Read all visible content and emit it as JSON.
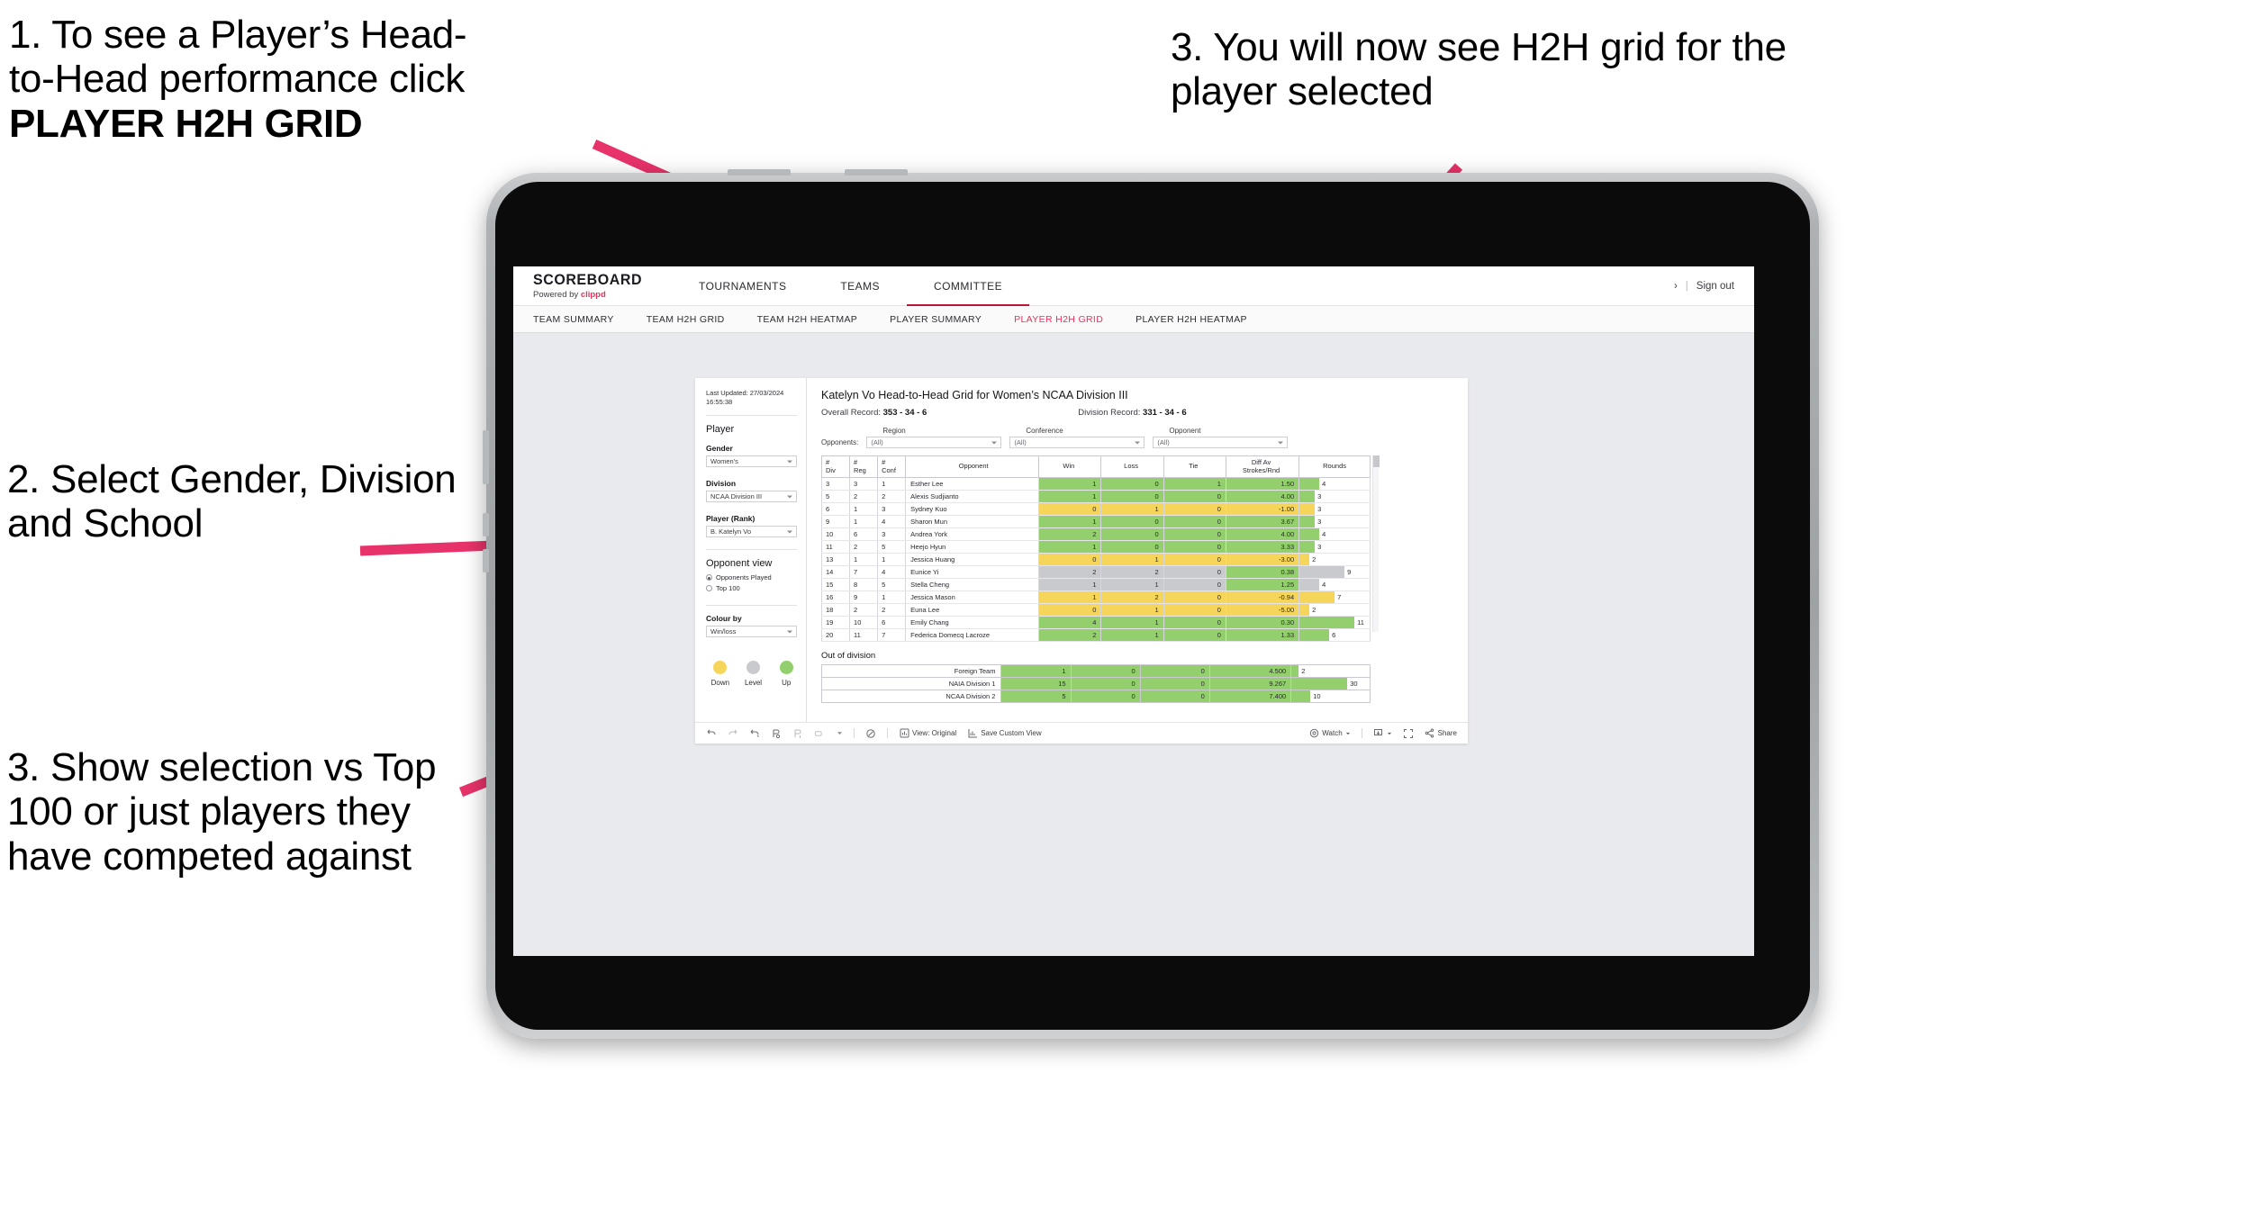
{
  "annotations": [
    {
      "id": "anno1",
      "line1": "1. To see a Player’s Head-",
      "line2": "to-Head performance click",
      "line3": "PLAYER H2H GRID"
    },
    {
      "id": "anno2",
      "text": "2. Select Gender, Division and School"
    },
    {
      "id": "anno3",
      "text": "3. Show selection vs Top 100 or just players they have competed against"
    },
    {
      "id": "anno4",
      "text": "3. You will now see H2H grid for the player selected"
    }
  ],
  "anno1_l1": "1. To see a Player’s Head-",
  "anno1_l2": "to-Head performance click",
  "anno1_l3": "PLAYER H2H GRID",
  "anno2_text": "2. Select Gender, Division and School",
  "anno3_text": "3. Show selection vs Top 100 or just players they have competed against",
  "anno4_text": "3. You will now see H2H grid for the player selected",
  "colors": {
    "accent_pink": "#e8335a",
    "arrow_pink": "#e8326a",
    "win_green": "#94cf6e",
    "loss_yellow": "#f5d65a",
    "level_grey": "#c9cacd",
    "active_tab_underline": "#c0133a"
  },
  "brand": {
    "title": "SCOREBOARD",
    "powered_prefix": "Powered by ",
    "powered_brand": "clippd"
  },
  "topnav": {
    "items": [
      {
        "label": "TOURNAMENTS",
        "active": false
      },
      {
        "label": "TEAMS",
        "active": false
      },
      {
        "label": "COMMITTEE",
        "active": true
      }
    ],
    "chevron": "›",
    "separator": "|",
    "signout": "Sign out"
  },
  "subnav": {
    "items": [
      {
        "label": "TEAM SUMMARY",
        "active": false
      },
      {
        "label": "TEAM H2H GRID",
        "active": false
      },
      {
        "label": "TEAM H2H HEATMAP",
        "active": false
      },
      {
        "label": "PLAYER SUMMARY",
        "active": false
      },
      {
        "label": "PLAYER H2H GRID",
        "active": true
      },
      {
        "label": "PLAYER H2H HEATMAP",
        "active": false
      }
    ]
  },
  "sidebar": {
    "last_updated_line1": "Last Updated: 27/03/2024",
    "last_updated_line2": "16:55:38",
    "player_heading": "Player",
    "gender_label": "Gender",
    "gender_value": "Women's",
    "division_label": "Division",
    "division_value": "NCAA Division III",
    "player_rank_label": "Player (Rank)",
    "player_rank_value": "B. Katelyn Vo",
    "opponent_view_heading": "Opponent view",
    "opponent_view_options": [
      {
        "label": "Opponents Played",
        "selected": true
      },
      {
        "label": "Top 100",
        "selected": false
      }
    ],
    "colour_by_label": "Colour by",
    "colour_by_value": "Win/loss",
    "legend": [
      {
        "label": "Down",
        "color": "#f5d65a"
      },
      {
        "label": "Level",
        "color": "#c9cacd"
      },
      {
        "label": "Up",
        "color": "#94cf6e"
      }
    ]
  },
  "main": {
    "title": "Katelyn Vo Head-to-Head Grid for Women’s NCAA Division III",
    "overall_record_label": "Overall Record: ",
    "overall_record_value": "353 -  34 - 6",
    "division_record_label": "Division Record: ",
    "division_record_value": "331 -  34 - 6",
    "opponents_label": "Opponents:",
    "filters": [
      {
        "title": "Region",
        "value": "(All)"
      },
      {
        "title": "Conference",
        "value": "(All)"
      },
      {
        "title": "Opponent",
        "value": "(All)"
      }
    ],
    "out_of_division_title": "Out of division"
  },
  "chart_data": {
    "type": "table",
    "title": "Katelyn Vo Head-to-Head Grid for Women’s NCAA Division III",
    "columns": [
      "# Div",
      "# Reg",
      "# Conf",
      "Opponent",
      "Win",
      "Loss",
      "Tie",
      "Diff Av Strokes/Rnd",
      "Rounds"
    ],
    "column_headers_multiline": [
      {
        "l1": "#",
        "l2": "Div"
      },
      {
        "l1": "#",
        "l2": "Reg"
      },
      {
        "l1": "#",
        "l2": "Conf"
      },
      {
        "l1": "Opponent",
        "l2": ""
      },
      {
        "l1": "Win",
        "l2": ""
      },
      {
        "l1": "Loss",
        "l2": ""
      },
      {
        "l1": "Tie",
        "l2": ""
      },
      {
        "l1": "Diff Av",
        "l2": "Strokes/Rnd"
      },
      {
        "l1": "Rounds",
        "l2": ""
      }
    ],
    "rounds_max": 12,
    "rows": [
      {
        "div": "3",
        "reg": "3",
        "conf": "1",
        "opponent": "Esther Lee",
        "win": "1",
        "loss": "0",
        "tie": "1",
        "diff": "1.50",
        "rounds": 4,
        "color": "#94cf6e"
      },
      {
        "div": "5",
        "reg": "2",
        "conf": "2",
        "opponent": "Alexis Sudjianto",
        "win": "1",
        "loss": "0",
        "tie": "0",
        "diff": "4.00",
        "rounds": 3,
        "color": "#94cf6e"
      },
      {
        "div": "6",
        "reg": "1",
        "conf": "3",
        "opponent": "Sydney Kuo",
        "win": "0",
        "loss": "1",
        "tie": "0",
        "diff": "-1.00",
        "rounds": 3,
        "color": "#f5d65a"
      },
      {
        "div": "9",
        "reg": "1",
        "conf": "4",
        "opponent": "Sharon Mun",
        "win": "1",
        "loss": "0",
        "tie": "0",
        "diff": "3.67",
        "rounds": 3,
        "color": "#94cf6e"
      },
      {
        "div": "10",
        "reg": "6",
        "conf": "3",
        "opponent": "Andrea York",
        "win": "2",
        "loss": "0",
        "tie": "0",
        "diff": "4.00",
        "rounds": 4,
        "color": "#94cf6e"
      },
      {
        "div": "11",
        "reg": "2",
        "conf": "5",
        "opponent": "Heejo Hyun",
        "win": "1",
        "loss": "0",
        "tie": "0",
        "diff": "3.33",
        "rounds": 3,
        "color": "#94cf6e"
      },
      {
        "div": "13",
        "reg": "1",
        "conf": "1",
        "opponent": "Jessica Huang",
        "win": "0",
        "loss": "1",
        "tie": "0",
        "diff": "-3.00",
        "rounds": 2,
        "color": "#f5d65a"
      },
      {
        "div": "14",
        "reg": "7",
        "conf": "4",
        "opponent": "Eunice Yi",
        "win": "2",
        "loss": "2",
        "tie": "0",
        "diff": "0.38",
        "rounds": 9,
        "color": "#c9cacd",
        "diff_color": "#94cf6e"
      },
      {
        "div": "15",
        "reg": "8",
        "conf": "5",
        "opponent": "Stella Cheng",
        "win": "1",
        "loss": "1",
        "tie": "0",
        "diff": "1.25",
        "rounds": 4,
        "color": "#c9cacd",
        "diff_color": "#94cf6e"
      },
      {
        "div": "16",
        "reg": "9",
        "conf": "1",
        "opponent": "Jessica Mason",
        "win": "1",
        "loss": "2",
        "tie": "0",
        "diff": "-0.94",
        "rounds": 7,
        "color": "#f5d65a"
      },
      {
        "div": "18",
        "reg": "2",
        "conf": "2",
        "opponent": "Euna Lee",
        "win": "0",
        "loss": "1",
        "tie": "0",
        "diff": "-5.00",
        "rounds": 2,
        "color": "#f5d65a"
      },
      {
        "div": "19",
        "reg": "10",
        "conf": "6",
        "opponent": "Emily Chang",
        "win": "4",
        "loss": "1",
        "tie": "0",
        "diff": "0.30",
        "rounds": 11,
        "color": "#94cf6e"
      },
      {
        "div": "20",
        "reg": "11",
        "conf": "7",
        "opponent": "Federica Domecq Lacroze",
        "win": "2",
        "loss": "1",
        "tie": "0",
        "diff": "1.33",
        "rounds": 6,
        "color": "#94cf6e"
      }
    ],
    "out_of_division": {
      "rounds_max": 32,
      "rows": [
        {
          "name": "Foreign Team",
          "win": "1",
          "loss": "0",
          "tie": "0",
          "diff": "4.500",
          "rounds": 2,
          "color": "#94cf6e"
        },
        {
          "name": "NAIA Division 1",
          "win": "15",
          "loss": "0",
          "tie": "0",
          "diff": "9.267",
          "rounds": 30,
          "color": "#94cf6e"
        },
        {
          "name": "NCAA Division 2",
          "win": "5",
          "loss": "0",
          "tie": "0",
          "diff": "7.400",
          "rounds": 10,
          "color": "#94cf6e"
        }
      ]
    }
  },
  "toolbar": {
    "view_label": "View: Original",
    "save_label": "Save Custom View",
    "watch_label": "Watch",
    "share_label": "Share"
  }
}
